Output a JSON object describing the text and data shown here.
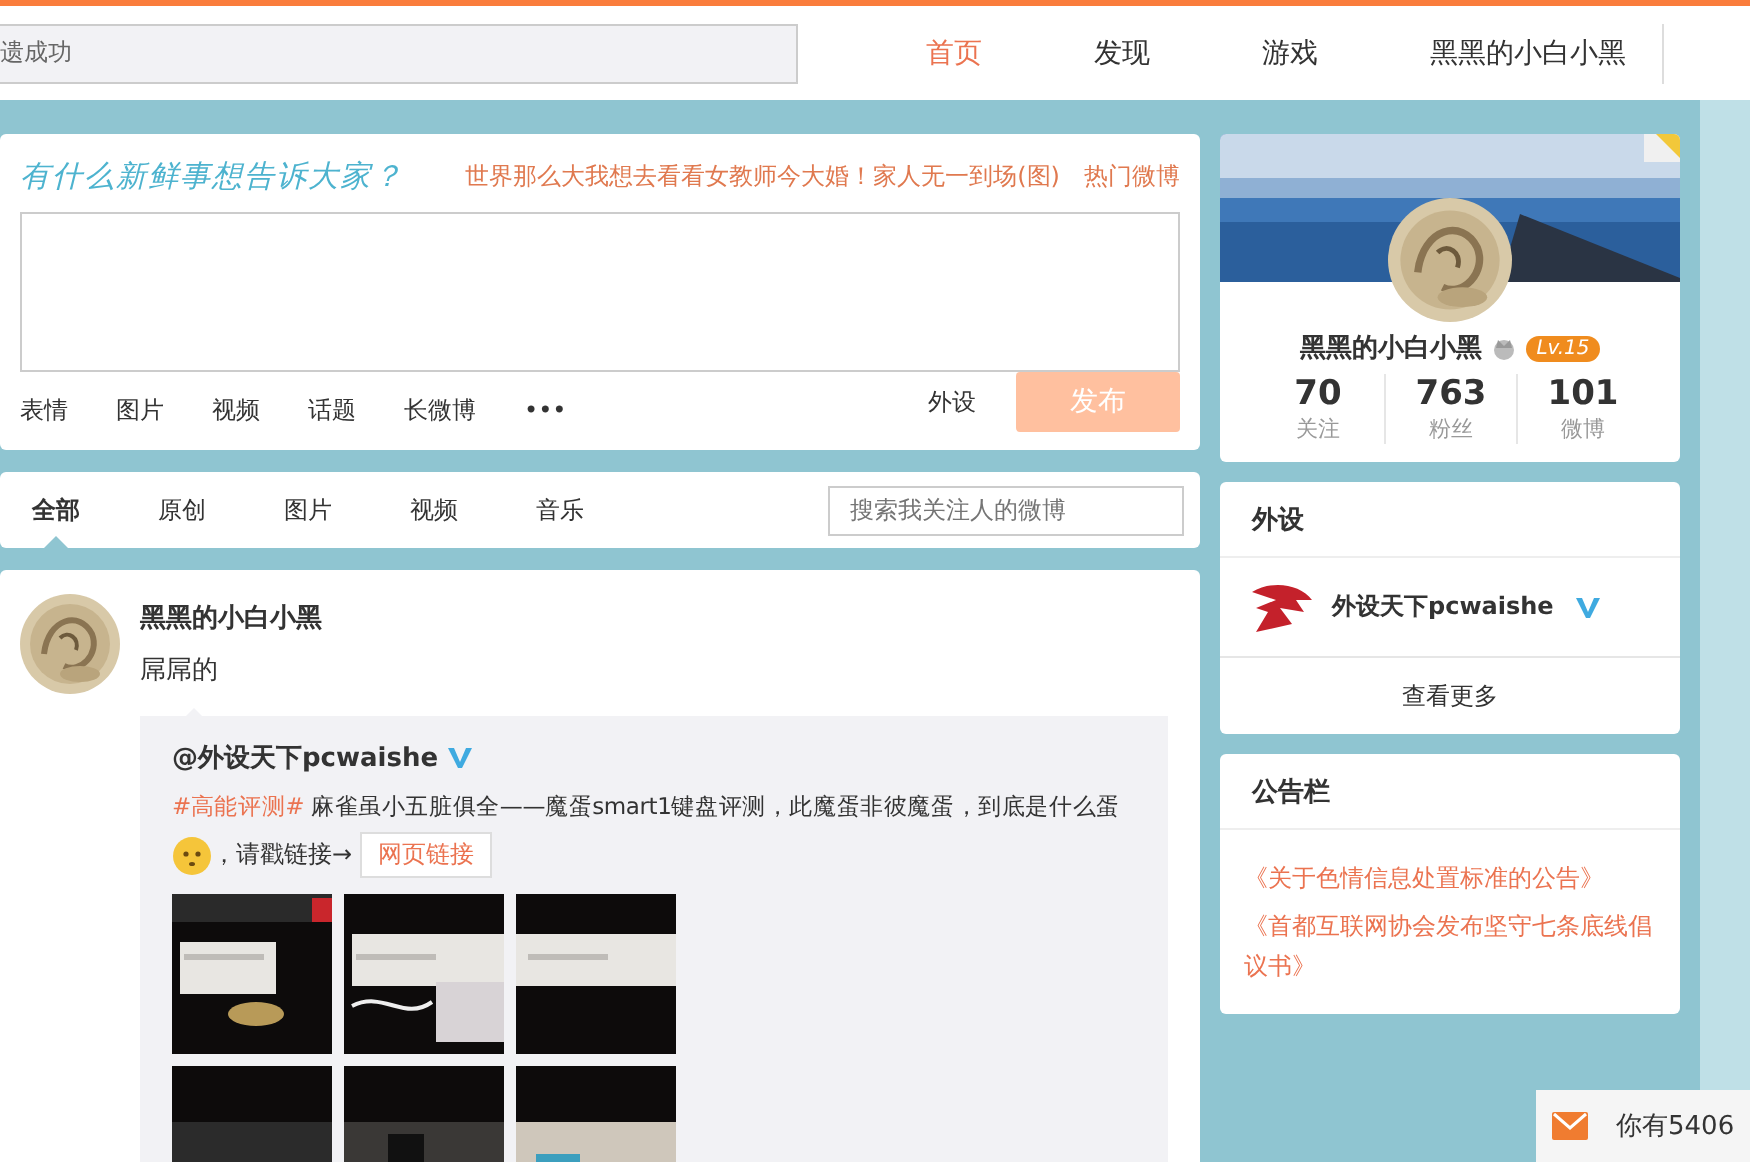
{
  "top_bar": {
    "search": {
      "value": "遗成功"
    },
    "nav": [
      {
        "label": "首页",
        "selected": true
      },
      {
        "label": "发现",
        "selected": false
      },
      {
        "label": "游戏",
        "selected": false
      },
      {
        "label": "黑黑的小白小黑",
        "selected": false
      }
    ]
  },
  "composer": {
    "prompt": "有什么新鲜事想告诉大家？",
    "hot_topic": "世界那么大我想去看看女教师今大婚！家人无一到场(图)",
    "hot_link": "热门微博",
    "tools": [
      "表情",
      "图片",
      "视频",
      "话题",
      "长微博",
      "•••"
    ],
    "group": "外设",
    "submit": "发布",
    "submit_disabled": true
  },
  "feed_tabs": [
    {
      "label": "全部",
      "selected": true
    },
    {
      "label": "原创",
      "selected": false
    },
    {
      "label": "图片",
      "selected": false
    },
    {
      "label": "视频",
      "selected": false
    },
    {
      "label": "音乐",
      "selected": false
    }
  ],
  "feed_search": {
    "placeholder": "搜索我关注人的微博"
  },
  "post": {
    "author": "黑黑的小白小黑",
    "text": "屌屌的",
    "repost": {
      "author": "@外设天下pcwaishe",
      "verified": true,
      "tag": "#高能评测#",
      "text": " 麻雀虽小五脏俱全——魔蛋smart1键盘评测，此魔蛋非彼魔蛋，到底是什么蛋",
      "suffix": "，请戳链接→",
      "link": "网页链接"
    }
  },
  "profile": {
    "name": "黑黑的小白小黑",
    "level": "Lv.15",
    "stats": [
      {
        "value": "70",
        "label": "关注"
      },
      {
        "value": "763",
        "label": "粉丝"
      },
      {
        "value": "101",
        "label": "微博"
      }
    ]
  },
  "recommend": {
    "title": "外设",
    "account": {
      "name": "外设天下pcwaishe",
      "verified": true
    },
    "more": "查看更多"
  },
  "notice": {
    "title": "公告栏",
    "items": [
      "《关于色情信息处置标准的公告》",
      "《首都互联网协会发布坚守七条底线倡议书》"
    ]
  },
  "notification": {
    "text": "你有5406"
  }
}
